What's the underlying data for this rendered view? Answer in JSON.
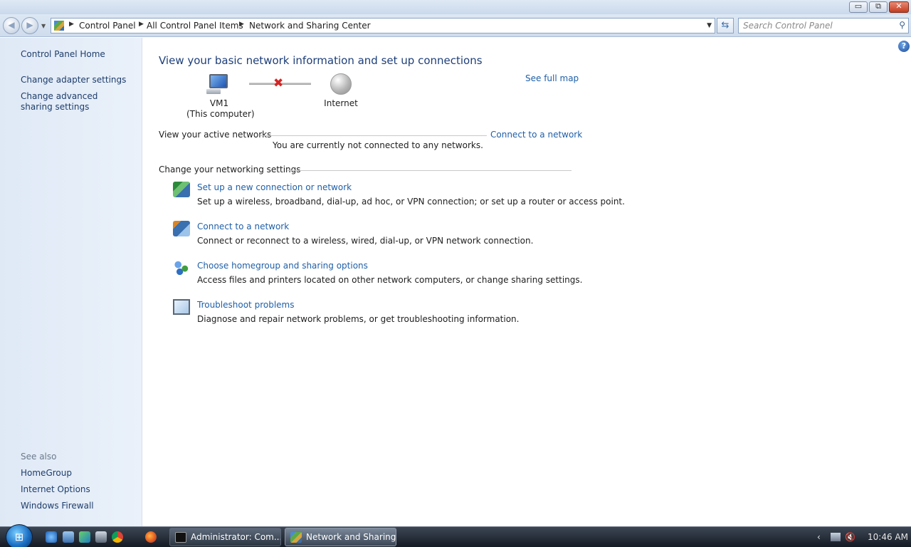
{
  "window": {
    "minimize_glyph": "▭",
    "maximize_glyph": "⧉",
    "close_glyph": "✕"
  },
  "nav": {
    "breadcrumbs": [
      "Control Panel",
      "All Control Panel Items",
      "Network and Sharing Center"
    ],
    "search_placeholder": "Search Control Panel"
  },
  "sidebar": {
    "home": "Control Panel Home",
    "links": [
      "Change adapter settings",
      "Change advanced sharing settings"
    ],
    "see_also_heading": "See also",
    "see_also": [
      "HomeGroup",
      "Internet Options",
      "Windows Firewall"
    ]
  },
  "main": {
    "title": "View your basic network information and set up connections",
    "see_full_map": "See full map",
    "map": {
      "computer_name": "VM1",
      "computer_sub": "(This computer)",
      "internet": "Internet",
      "connection_status": "disconnected"
    },
    "active_networks": {
      "heading": "View your active networks",
      "connect_link": "Connect to a network",
      "status": "You are currently not connected to any networks."
    },
    "settings": {
      "heading": "Change your networking settings",
      "tasks": [
        {
          "icon": "setup-connection-icon",
          "title": "Set up a new connection or network",
          "description": "Set up a wireless, broadband, dial-up, ad hoc, or VPN connection; or set up a router or access point."
        },
        {
          "icon": "connect-network-icon",
          "title": "Connect to a network",
          "description": "Connect or reconnect to a wireless, wired, dial-up, or VPN network connection."
        },
        {
          "icon": "homegroup-icon",
          "title": "Choose homegroup and sharing options",
          "description": "Access files and printers located on other network computers, or change sharing settings."
        },
        {
          "icon": "troubleshoot-icon",
          "title": "Troubleshoot problems",
          "description": "Diagnose and repair network problems, or get troubleshooting information."
        }
      ]
    }
  },
  "taskbar": {
    "buttons": [
      {
        "label": "Administrator:  Com...",
        "active": false
      },
      {
        "label": "Network and Sharing...",
        "active": true
      }
    ],
    "clock": "10:46 AM"
  },
  "colors": {
    "link": "#1f5fa8",
    "title": "#1e3f7a",
    "sidebar_bg": "#dfe9f6",
    "disconnect_x": "#d62424"
  }
}
